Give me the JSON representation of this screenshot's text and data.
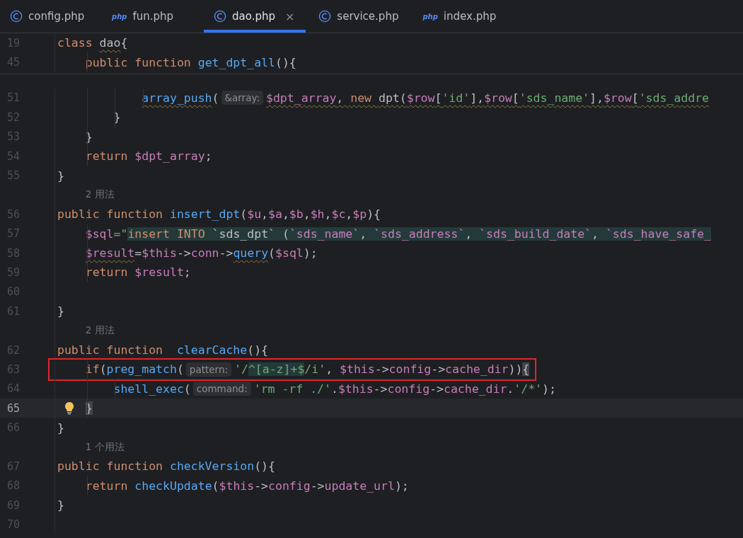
{
  "tabs": [
    {
      "label": "config.php",
      "kind": "class",
      "selected": false
    },
    {
      "label": "fun.php",
      "kind": "php",
      "badge": "php",
      "selected": false
    },
    {
      "label": "dao.php",
      "kind": "class",
      "selected": true,
      "close": "×"
    },
    {
      "label": "service.php",
      "kind": "class",
      "selected": false
    },
    {
      "label": "index.php",
      "kind": "php",
      "badge": "php",
      "selected": false
    }
  ],
  "sticky_lines": [
    {
      "kind": "code",
      "number": "19",
      "tokens": [
        {
          "t": "class ",
          "kind": "kw"
        },
        {
          "t": "dao",
          "kind": "plain",
          "squiggly": true
        },
        {
          "t": "{",
          "kind": "plain"
        }
      ]
    },
    {
      "kind": "code",
      "number": "45",
      "tokens": [
        {
          "t": "    public function ",
          "kind": "kw"
        },
        {
          "t": "get_dpt_all",
          "kind": "fn"
        },
        {
          "t": "(){",
          "kind": "plain"
        }
      ]
    }
  ],
  "lines": [
    {
      "kind": "code",
      "number": "51",
      "tokens": [
        {
          "t": "            array_push",
          "kind": "fn",
          "squiggly": true
        },
        {
          "t": "(",
          "kind": "plain"
        },
        {
          "t": "&array:",
          "kind": "hint"
        },
        {
          "t": "$dpt_array",
          "kind": "var",
          "squiggly": true
        },
        {
          "t": ", ",
          "kind": "plain",
          "squiggly": true
        },
        {
          "t": "new ",
          "kind": "kw",
          "squiggly": true
        },
        {
          "t": "dpt(",
          "kind": "plain",
          "squiggly": true
        },
        {
          "t": "$row",
          "kind": "var",
          "squiggly": true
        },
        {
          "t": "[",
          "kind": "plain",
          "squiggly": true
        },
        {
          "t": "'id'",
          "kind": "str",
          "squiggly": true
        },
        {
          "t": "],",
          "kind": "plain",
          "squiggly": true
        },
        {
          "t": "$row",
          "kind": "var",
          "squiggly": true
        },
        {
          "t": "[",
          "kind": "plain",
          "squiggly": true
        },
        {
          "t": "'sds_name'",
          "kind": "str",
          "squiggly": true
        },
        {
          "t": "],",
          "kind": "plain",
          "squiggly": true
        },
        {
          "t": "$row",
          "kind": "var",
          "squiggly": true
        },
        {
          "t": "[",
          "kind": "plain",
          "squiggly": true
        },
        {
          "t": "'sds_addre",
          "kind": "str",
          "squiggly": true
        }
      ]
    },
    {
      "kind": "code",
      "number": "52",
      "tokens": [
        {
          "t": "        }",
          "kind": "plain"
        }
      ]
    },
    {
      "kind": "code",
      "number": "53",
      "tokens": [
        {
          "t": "    }",
          "kind": "plain"
        }
      ]
    },
    {
      "kind": "code",
      "number": "54",
      "tokens": [
        {
          "t": "    return ",
          "kind": "kw"
        },
        {
          "t": "$dpt_array",
          "kind": "var"
        },
        {
          "t": ";",
          "kind": "plain"
        }
      ]
    },
    {
      "kind": "code",
      "number": "55",
      "tokens": [
        {
          "t": "}",
          "kind": "plain"
        }
      ]
    },
    {
      "kind": "usage",
      "text": "2 用法"
    },
    {
      "kind": "code",
      "number": "56",
      "tokens": [
        {
          "t": "public function ",
          "kind": "kw"
        },
        {
          "t": "insert_dpt",
          "kind": "fn"
        },
        {
          "t": "(",
          "kind": "plain"
        },
        {
          "t": "$u",
          "kind": "var"
        },
        {
          "t": ",",
          "kind": "plain"
        },
        {
          "t": "$a",
          "kind": "var"
        },
        {
          "t": ",",
          "kind": "plain"
        },
        {
          "t": "$b",
          "kind": "var"
        },
        {
          "t": ",",
          "kind": "plain"
        },
        {
          "t": "$h",
          "kind": "var"
        },
        {
          "t": ",",
          "kind": "plain"
        },
        {
          "t": "$c",
          "kind": "var"
        },
        {
          "t": ",",
          "kind": "plain"
        },
        {
          "t": "$p",
          "kind": "var"
        },
        {
          "t": "){",
          "kind": "plain"
        }
      ]
    },
    {
      "kind": "code",
      "number": "57",
      "tokens": [
        {
          "t": "    $sql",
          "kind": "var"
        },
        {
          "t": "=\"",
          "kind": "str"
        },
        {
          "t": "insert INTO ",
          "kind": "kw",
          "injected": true
        },
        {
          "t": "`sds_dpt` (",
          "kind": "plain",
          "injected": true
        },
        {
          "t": "`sds_name`",
          "kind": "var",
          "injected": true
        },
        {
          "t": ", ",
          "kind": "plain",
          "injected": true
        },
        {
          "t": "`sds_address`",
          "kind": "var",
          "injected": true
        },
        {
          "t": ", ",
          "kind": "plain",
          "injected": true
        },
        {
          "t": "`sds_build_date`",
          "kind": "var",
          "injected": true
        },
        {
          "t": ", ",
          "kind": "plain",
          "injected": true
        },
        {
          "t": "`sds_have_safe_",
          "kind": "var",
          "injected": true
        }
      ]
    },
    {
      "kind": "code",
      "number": "58",
      "tokens": [
        {
          "t": "    $result",
          "kind": "var",
          "squiggly": true
        },
        {
          "t": "=",
          "kind": "plain"
        },
        {
          "t": "$this",
          "kind": "var"
        },
        {
          "t": "->",
          "kind": "plain"
        },
        {
          "t": "conn",
          "kind": "var"
        },
        {
          "t": "->",
          "kind": "plain"
        },
        {
          "t": "query",
          "kind": "fn",
          "squiggly": true
        },
        {
          "t": "(",
          "kind": "plain"
        },
        {
          "t": "$sql",
          "kind": "var"
        },
        {
          "t": ");",
          "kind": "plain"
        }
      ]
    },
    {
      "kind": "code",
      "number": "59",
      "tokens": [
        {
          "t": "    return ",
          "kind": "kw"
        },
        {
          "t": "$result",
          "kind": "var"
        },
        {
          "t": ";",
          "kind": "plain"
        }
      ]
    },
    {
      "kind": "code",
      "number": "60"
    },
    {
      "kind": "code",
      "number": "61",
      "tokens": [
        {
          "t": "}",
          "kind": "plain"
        }
      ]
    },
    {
      "kind": "usage",
      "text": "2 用法"
    },
    {
      "kind": "code",
      "number": "62",
      "tokens": [
        {
          "t": "public function  ",
          "kind": "kw"
        },
        {
          "t": "clearCache",
          "kind": "fn"
        },
        {
          "t": "(){",
          "kind": "plain"
        }
      ]
    },
    {
      "kind": "code",
      "number": "63",
      "boxed": true,
      "tokens": [
        {
          "t": "    if",
          "kind": "kw"
        },
        {
          "t": "(",
          "kind": "plain"
        },
        {
          "t": "preg_match",
          "kind": "fn"
        },
        {
          "t": "(",
          "kind": "plain"
        },
        {
          "t": "pattern:",
          "kind": "hint"
        },
        {
          "t": "'/",
          "kind": "str"
        },
        {
          "t": "^[a-z]+$",
          "kind": "str",
          "injected": true
        },
        {
          "t": "/i'",
          "kind": "str"
        },
        {
          "t": ", ",
          "kind": "plain"
        },
        {
          "t": "$this",
          "kind": "var"
        },
        {
          "t": "->",
          "kind": "plain"
        },
        {
          "t": "config",
          "kind": "var"
        },
        {
          "t": "->",
          "kind": "plain"
        },
        {
          "t": "cache_dir",
          "kind": "var"
        },
        {
          "t": "))",
          "kind": "plain"
        },
        {
          "t": "{",
          "kind": "plain",
          "matched": true
        }
      ]
    },
    {
      "kind": "code",
      "number": "64",
      "tokens": [
        {
          "t": "        shell_exec",
          "kind": "fn"
        },
        {
          "t": "(",
          "kind": "plain"
        },
        {
          "t": "command:",
          "kind": "hint"
        },
        {
          "t": "'rm -rf ./'",
          "kind": "str"
        },
        {
          "t": ".",
          "kind": "plain"
        },
        {
          "t": "$this",
          "kind": "var"
        },
        {
          "t": "->",
          "kind": "plain"
        },
        {
          "t": "config",
          "kind": "var"
        },
        {
          "t": "->",
          "kind": "plain"
        },
        {
          "t": "cache_dir",
          "kind": "var"
        },
        {
          "t": ".",
          "kind": "plain"
        },
        {
          "t": "'/*'",
          "kind": "str"
        },
        {
          "t": ");",
          "kind": "plain"
        }
      ]
    },
    {
      "kind": "current",
      "number": "65",
      "bulb": true,
      "tokens": [
        {
          "t": "    }",
          "kind": "plain",
          "matched": true
        }
      ]
    },
    {
      "kind": "code",
      "number": "66",
      "tokens": [
        {
          "t": "}",
          "kind": "plain"
        }
      ]
    },
    {
      "kind": "usage",
      "text": "1 个用法"
    },
    {
      "kind": "code",
      "number": "67",
      "tokens": [
        {
          "t": "public function ",
          "kind": "kw"
        },
        {
          "t": "checkVersion",
          "kind": "fn"
        },
        {
          "t": "(){",
          "kind": "plain"
        }
      ]
    },
    {
      "kind": "code",
      "number": "68",
      "tokens": [
        {
          "t": "    return ",
          "kind": "kw"
        },
        {
          "t": "checkUpdate",
          "kind": "fn"
        },
        {
          "t": "(",
          "kind": "plain"
        },
        {
          "t": "$this",
          "kind": "var"
        },
        {
          "t": "->",
          "kind": "plain"
        },
        {
          "t": "config",
          "kind": "var"
        },
        {
          "t": "->",
          "kind": "plain"
        },
        {
          "t": "update_url",
          "kind": "var"
        },
        {
          "t": ");",
          "kind": "plain"
        }
      ]
    },
    {
      "kind": "code",
      "number": "69",
      "tokens": [
        {
          "t": "}",
          "kind": "plain"
        }
      ]
    },
    {
      "kind": "code",
      "number": "70"
    }
  ]
}
